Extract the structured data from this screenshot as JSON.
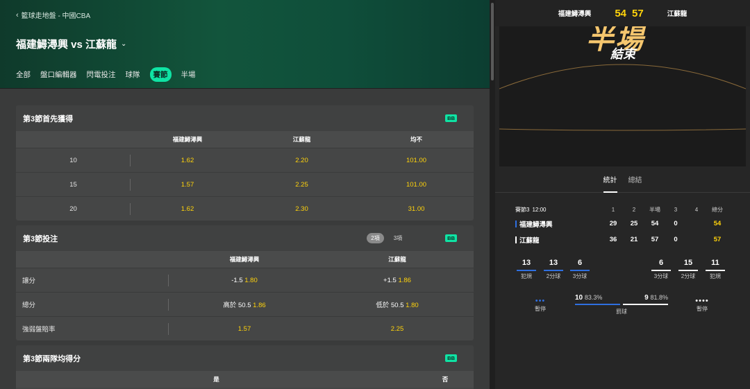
{
  "breadcrumb": "籃球走地盤 - 中國CBA",
  "match": {
    "title": "福建鱘潯興 vs 江蘇龍",
    "tabs": [
      "全部",
      "盤口編輯器",
      "閃電投注",
      "球隊",
      "賽節",
      "半場"
    ],
    "active_tab": "賽節"
  },
  "markets": [
    {
      "title": "第3節首先獲得",
      "badge": "BB",
      "columns": [
        "福建鱘潯興",
        "江蘇龍",
        "均不"
      ],
      "rows": [
        {
          "label": "10",
          "odds": [
            "1.62",
            "2.20",
            "101.00"
          ]
        },
        {
          "label": "15",
          "odds": [
            "1.57",
            "2.25",
            "101.00"
          ]
        },
        {
          "label": "20",
          "odds": [
            "1.62",
            "2.30",
            "31.00"
          ]
        }
      ]
    },
    {
      "title": "第3節投注",
      "badge": "BB",
      "pills": [
        "2項",
        "3項"
      ],
      "columns": [
        "福建鱘潯興",
        "江蘇龍"
      ],
      "rows": [
        {
          "label": "讓分",
          "home_line": "-1.5",
          "home_odd": "1.80",
          "away_line": "+1.5",
          "away_odd": "1.86"
        },
        {
          "label": "總分",
          "home_line": "高於 50.5",
          "home_odd": "1.86",
          "away_line": "低於 50.5",
          "away_odd": "1.80"
        },
        {
          "label": "強弱盤賠率",
          "home_line": "",
          "home_odd": "1.57",
          "away_line": "",
          "away_odd": "2.25"
        }
      ]
    },
    {
      "title": "第3節兩隊均得分",
      "badge": "BB",
      "columns": [
        "是",
        "否"
      ]
    }
  ],
  "scoreboard": {
    "home": "福建鱘潯興",
    "away": "江蘇龍",
    "home_score": "54",
    "away_score": "57",
    "banner_big": "半場",
    "banner_small": "結束"
  },
  "stat_tabs": [
    "統計",
    "總結"
  ],
  "period_table": {
    "period_label": "賽節3",
    "clock": "12:00",
    "headers": [
      "1",
      "2",
      "半場",
      "3",
      "4",
      "總分"
    ],
    "home": {
      "name": "福建鱘潯興",
      "q": [
        "29",
        "25",
        "54",
        "0",
        "",
        "54"
      ],
      "color": "#2f6fe0"
    },
    "away": {
      "name": "江蘇龍",
      "q": [
        "36",
        "21",
        "57",
        "0",
        "",
        "57"
      ],
      "color": "#ffffff"
    }
  },
  "comparison": {
    "home": [
      {
        "v": "13",
        "l": "犯規"
      },
      {
        "v": "13",
        "l": "2分球"
      },
      {
        "v": "6",
        "l": "3分球"
      }
    ],
    "away": [
      {
        "v": "6",
        "l": "3分球"
      },
      {
        "v": "15",
        "l": "2分球"
      },
      {
        "v": "11",
        "l": "犯規"
      }
    ],
    "timeouts_label": "暫停",
    "free_throw": {
      "home_v": "10",
      "home_p": "83.3%",
      "away_v": "9",
      "away_p": "81.8%",
      "label": "罰球"
    }
  },
  "colors": {
    "accent": "#0fe3a4",
    "odds": "#ffd30b",
    "home": "#2f6fe0",
    "away": "#ffffff"
  }
}
